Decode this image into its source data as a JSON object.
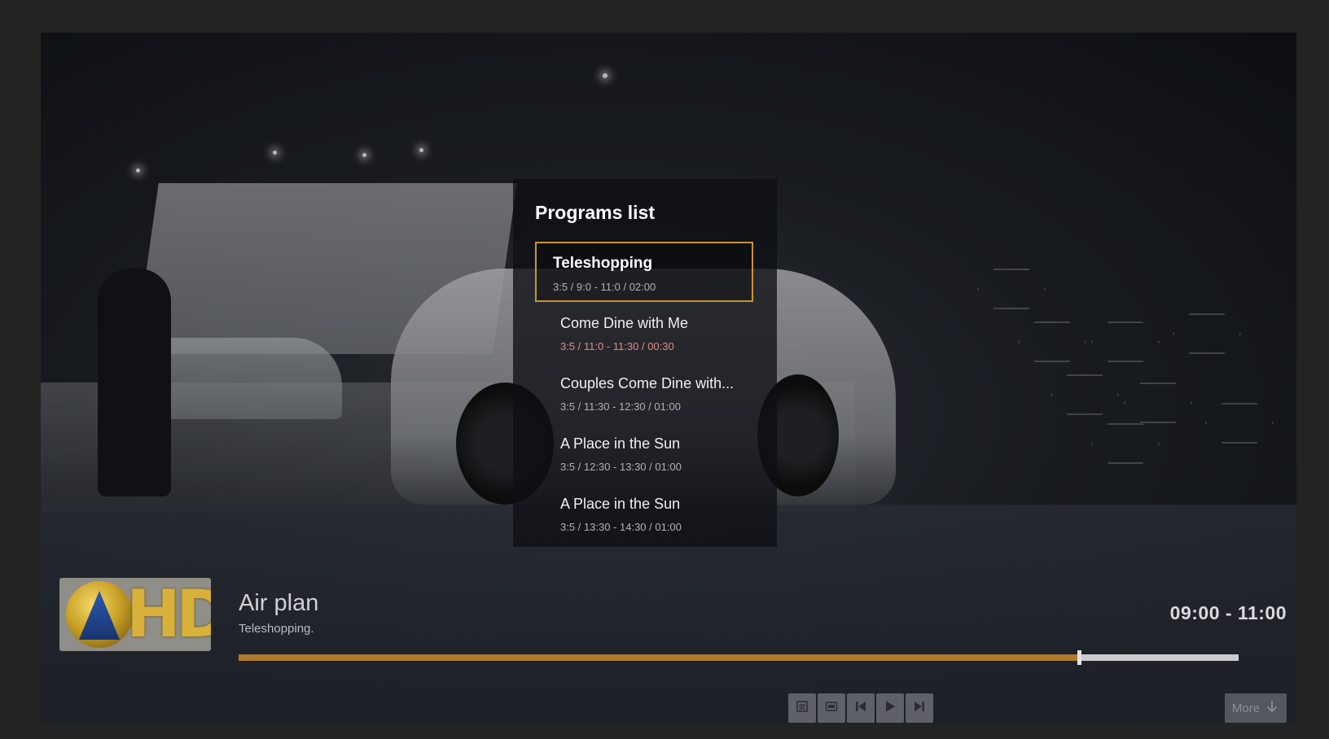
{
  "programs_list": {
    "title": "Programs list",
    "items": [
      {
        "name": "Teleshopping",
        "info": "3:5 / 9:0 - 11:0 / 02:00"
      },
      {
        "name": "Come Dine with Me",
        "info": "3:5 / 11:0 - 11:30 / 00:30"
      },
      {
        "name": "Couples Come Dine with...",
        "info": "3:5 / 11:30 - 12:30 / 01:00"
      },
      {
        "name": "A Place in the Sun",
        "info": "3:5 / 12:30 - 13:30 / 01:00"
      },
      {
        "name": "A Place in the Sun",
        "info": "3:5 / 13:30 - 14:30 / 01:00"
      }
    ]
  },
  "now_playing": {
    "channel_logo": "hd-channel-logo",
    "title": "Air plan",
    "subtitle": "Teleshopping.",
    "time_range": "09:00 - 11:00",
    "progress": 0.84
  },
  "controls": {
    "buttons": [
      "list-icon",
      "epg-icon",
      "skip-previous-icon",
      "play-icon",
      "skip-next-icon"
    ],
    "more_label": "More"
  },
  "colors": {
    "accent": "#c99533",
    "progress_fill": "#b07a2e",
    "alert_text": "#e08a86"
  }
}
